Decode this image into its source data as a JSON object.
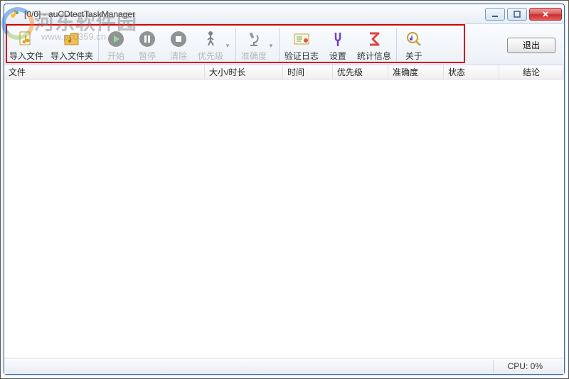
{
  "watermark": {
    "text": "河东软件园",
    "url": "www.pc0359.cn"
  },
  "window": {
    "title": "[0/0] - auCDtectTaskManager"
  },
  "toolbar": {
    "import_file": "导入文件",
    "import_folder": "导入文件夹",
    "start": "开始",
    "pause": "暂停",
    "clear": "清除",
    "priority": "优先级",
    "accuracy": "准确度",
    "verify_log": "验证日志",
    "settings": "设置",
    "stat_info": "统计信息",
    "about": "关于",
    "exit": "退出"
  },
  "columns": {
    "file": "文件",
    "size_duration": "大小/时长",
    "time": "时间",
    "priority": "优先级",
    "accuracy": "准确度",
    "status": "状态",
    "result": "结论"
  },
  "status": {
    "cpu": "CPU: 0%"
  }
}
